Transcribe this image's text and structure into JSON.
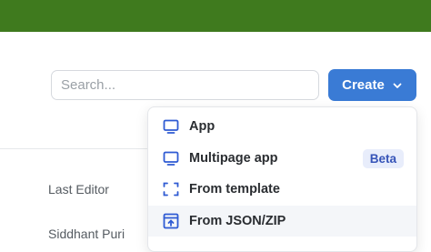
{
  "search": {
    "placeholder": "Search...",
    "value": ""
  },
  "create_button": {
    "label": "Create"
  },
  "table": {
    "column_header": "Last Editor",
    "rows": [
      {
        "last_editor": "Siddhant Puri"
      }
    ]
  },
  "create_menu": {
    "items": [
      {
        "label": "App",
        "icon": "monitor-icon"
      },
      {
        "label": "Multipage app",
        "icon": "monitor-icon",
        "badge": "Beta"
      },
      {
        "label": "From template",
        "icon": "template-frame-icon"
      },
      {
        "label": "From JSON/ZIP",
        "icon": "import-upload-icon"
      }
    ]
  },
  "colors": {
    "topbar": "#3f7a1e",
    "accent": "#3a7bd5",
    "icon_blue": "#2f5bd3",
    "badge_bg": "#e8edfb",
    "badge_text": "#3654b8"
  }
}
